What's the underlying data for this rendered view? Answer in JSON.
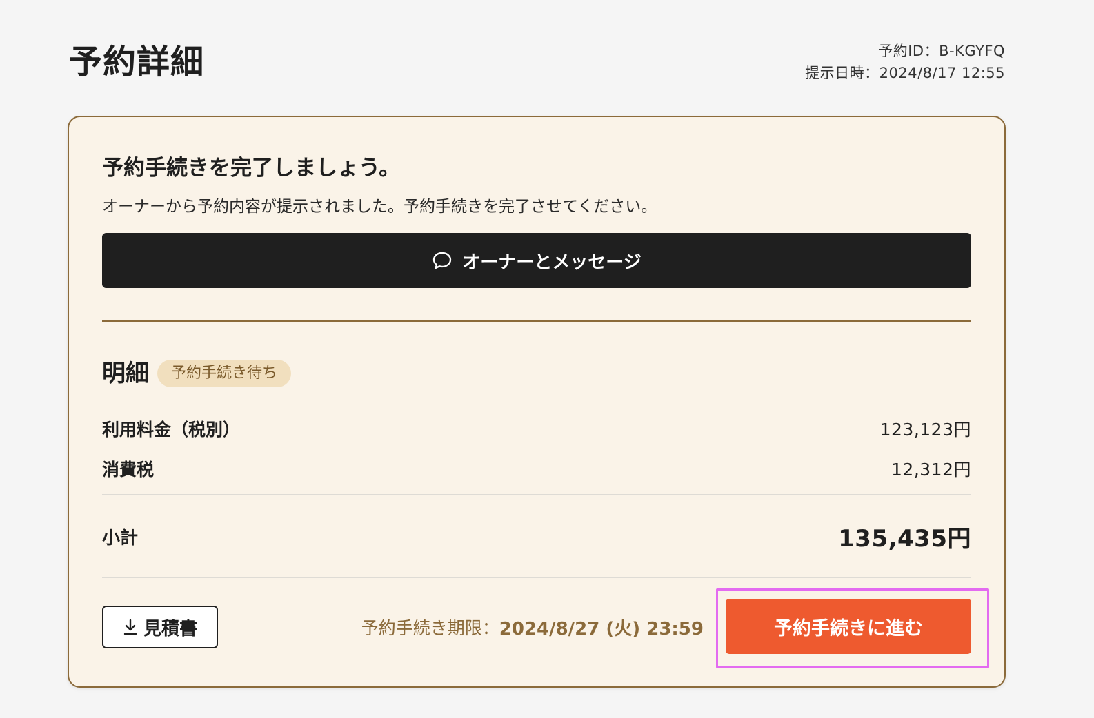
{
  "header": {
    "title": "予約詳細",
    "reservation_id": "予約ID：B-KGYFQ",
    "presented_at": "提示日時：2024/8/17 12:55"
  },
  "card": {
    "headline": "予約手続きを完了しましょう。",
    "subtext": "オーナーから予約内容が提示されました。予約手続きを完了させてください。",
    "message_button": {
      "icon": "speech-bubble-icon",
      "label": "オーナーとメッセージ"
    }
  },
  "details": {
    "title": "明細",
    "status_badge": "予約手続き待ち",
    "items": [
      {
        "label": "利用料金（税別）",
        "value": "123,123円"
      },
      {
        "label": "消費税",
        "value": "12,312円"
      }
    ],
    "subtotal": {
      "label": "小計",
      "value": "135,435円"
    }
  },
  "footer": {
    "quote_button": {
      "icon": "download-icon",
      "label": "見積書"
    },
    "deadline_label": "予約手続き期限：",
    "deadline_value": "2024/8/27 (火) 23:59",
    "proceed_button": "予約手続きに進む"
  },
  "colors": {
    "background": "#f5f5f5",
    "card_background": "#faf3e8",
    "card_border": "#8b6a3a",
    "primary_dark": "#1f1f1f",
    "accent_orange": "#ee5a2f",
    "badge_background": "#f1dfbe",
    "highlight": "#e36bf0"
  }
}
